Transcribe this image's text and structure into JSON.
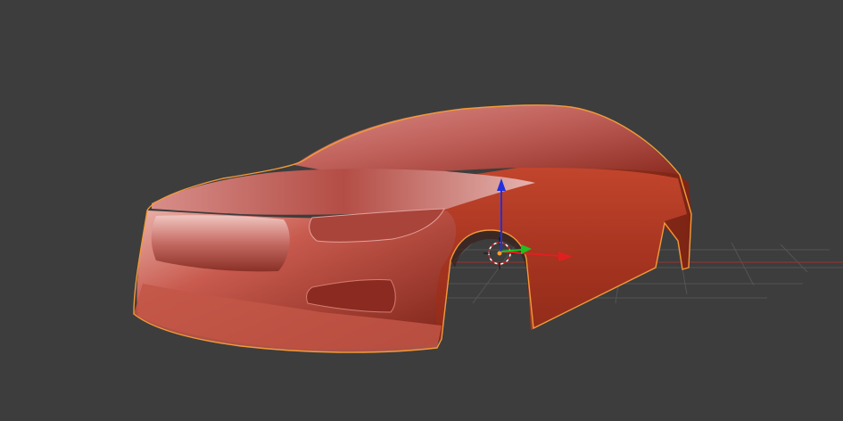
{
  "viewport": {
    "background_color": "#3d3d3d",
    "grid_color": "#545454",
    "x_axis_color": "#8a3434",
    "selection_outline_color": "#f29a3a"
  },
  "scene": {
    "object": {
      "semantic": "car-body-mesh",
      "base_color": "#b7402c",
      "highlight_color": "#e8a4a0",
      "shadow_color": "#5a140c",
      "selected": true
    },
    "gizmo": {
      "icon": "translate-gizmo-icon",
      "x_axis_color": "#e02020",
      "y_axis_color": "#20c020",
      "z_axis_color": "#2030e0"
    },
    "origin_icon": "3d-cursor-icon"
  }
}
